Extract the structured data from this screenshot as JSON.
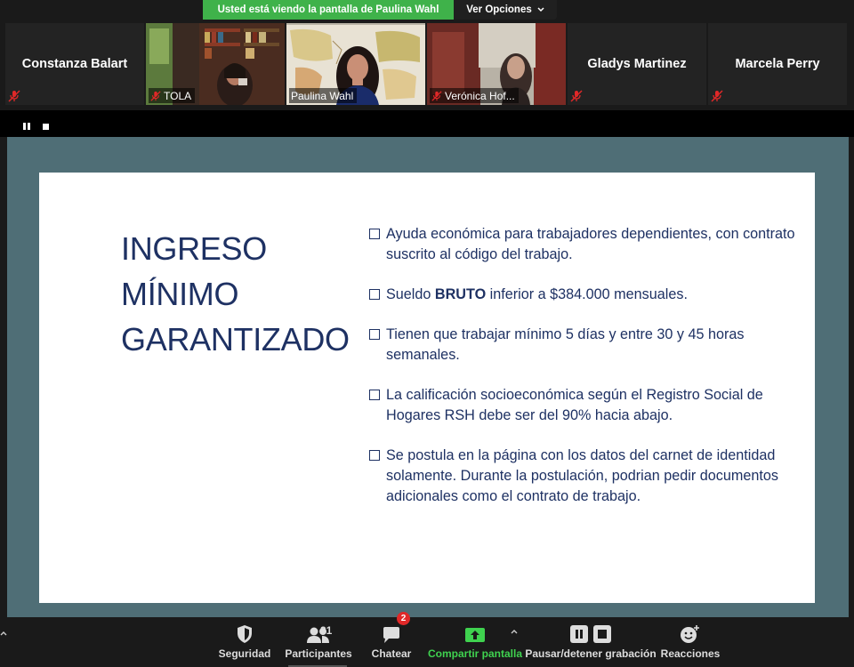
{
  "banner": {
    "message": "Usted está viendo la pantalla de Paulina Wahl",
    "options_label": "Ver Opciones"
  },
  "participants": [
    {
      "name": "Constanza Balart",
      "video": false,
      "muted": true
    },
    {
      "name": "TOLA",
      "video": true,
      "muted": true
    },
    {
      "name": "Paulina Wahl",
      "video": true,
      "muted": false,
      "active": true
    },
    {
      "name": "Verónica Hof...",
      "video": true,
      "muted": true
    },
    {
      "name": "Gladys Martinez",
      "video": false,
      "muted": true
    },
    {
      "name": "Marcela Perry",
      "video": false,
      "muted": true
    }
  ],
  "slide": {
    "title_lines": [
      "INGRESO",
      "MÍNIMO",
      "GARANTIZADO"
    ],
    "bullets": [
      {
        "pre": "Ayuda económica para trabajadores dependientes, con contrato suscrito al código del trabajo.",
        "bold": "",
        "post": ""
      },
      {
        "pre": "Sueldo ",
        "bold": "BRUTO",
        "post": " inferior a $384.000 mensuales."
      },
      {
        "pre": "Tienen que trabajar mínimo 5 días y entre 30 y 45 horas semanales.",
        "bold": "",
        "post": ""
      },
      {
        "pre": "La calificación socioeconómica según el Registro Social de Hogares RSH debe ser del 90% hacia abajo.",
        "bold": "",
        "post": ""
      },
      {
        "pre": "Se postula en la página con los datos del carnet de identidad solamente. Durante la postulación, podrian pedir documentos adicionales como el contrato de trabajo.",
        "bold": "",
        "post": ""
      }
    ]
  },
  "toolbar": {
    "security": "Seguridad",
    "participants": "Participantes",
    "participants_count": "31",
    "chat": "Chatear",
    "chat_badge": "2",
    "share": "Compartir pantalla",
    "record": "Pausar/detener grabación",
    "reactions": "Reacciones"
  },
  "colors": {
    "banner_green": "#3fb24a",
    "share_green": "#3fd24f",
    "slide_navy": "#1e3163",
    "screen_bg": "#4f6e76",
    "badge_red": "#e02828"
  }
}
